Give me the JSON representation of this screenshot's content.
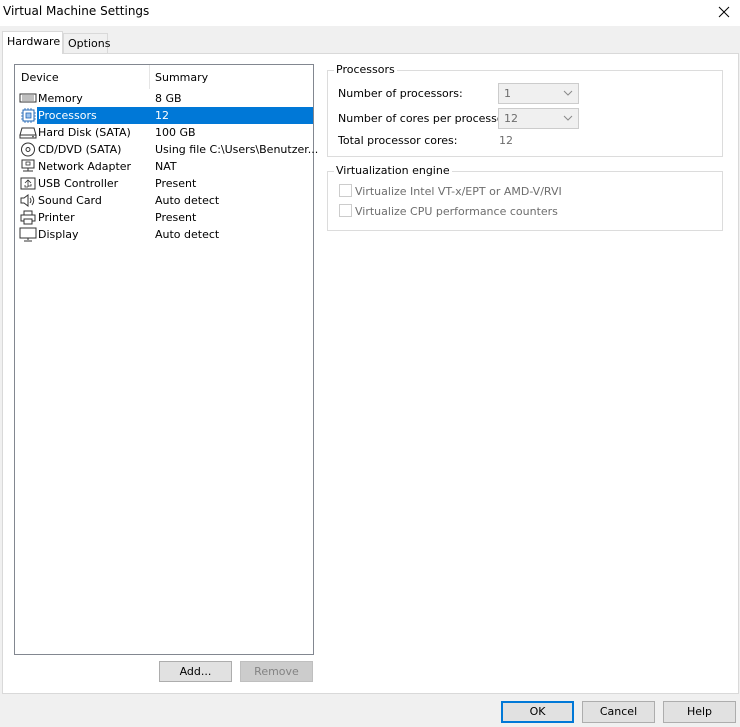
{
  "window": {
    "title": "Virtual Machine Settings"
  },
  "tabs": [
    {
      "label": "Hardware",
      "active": true
    },
    {
      "label": "Options",
      "active": false
    }
  ],
  "device_list": {
    "columns": [
      "Device",
      "Summary"
    ],
    "rows": [
      {
        "icon": "memory-icon",
        "device": "Memory",
        "summary": "8 GB"
      },
      {
        "icon": "processor-icon",
        "device": "Processors",
        "summary": "12",
        "selected": true
      },
      {
        "icon": "hard-disk-icon",
        "device": "Hard Disk (SATA)",
        "summary": "100 GB"
      },
      {
        "icon": "cd-dvd-icon",
        "device": "CD/DVD (SATA)",
        "summary": "Using file C:\\Users\\Benutzer..."
      },
      {
        "icon": "network-adapter-icon",
        "device": "Network Adapter",
        "summary": "NAT"
      },
      {
        "icon": "usb-icon",
        "device": "USB Controller",
        "summary": "Present"
      },
      {
        "icon": "sound-card-icon",
        "device": "Sound Card",
        "summary": "Auto detect"
      },
      {
        "icon": "printer-icon",
        "device": "Printer",
        "summary": "Present"
      },
      {
        "icon": "display-icon",
        "device": "Display",
        "summary": "Auto detect"
      }
    ]
  },
  "list_buttons": {
    "add": "Add...",
    "remove": "Remove"
  },
  "processors": {
    "legend": "Processors",
    "num_processors_label": "Number of processors:",
    "num_processors_value": "1",
    "cores_label": "Number of cores per processor:",
    "cores_value": "12",
    "total_label": "Total processor cores:",
    "total_value": "12"
  },
  "virtualization": {
    "legend": "Virtualization engine",
    "option1": "Virtualize Intel VT-x/EPT or AMD-V/RVI",
    "option2": "Virtualize CPU performance counters"
  },
  "dialog_buttons": {
    "ok": "OK",
    "cancel": "Cancel",
    "help": "Help"
  },
  "colors": {
    "selection": "#0078d7",
    "accent": "#0078d7"
  }
}
